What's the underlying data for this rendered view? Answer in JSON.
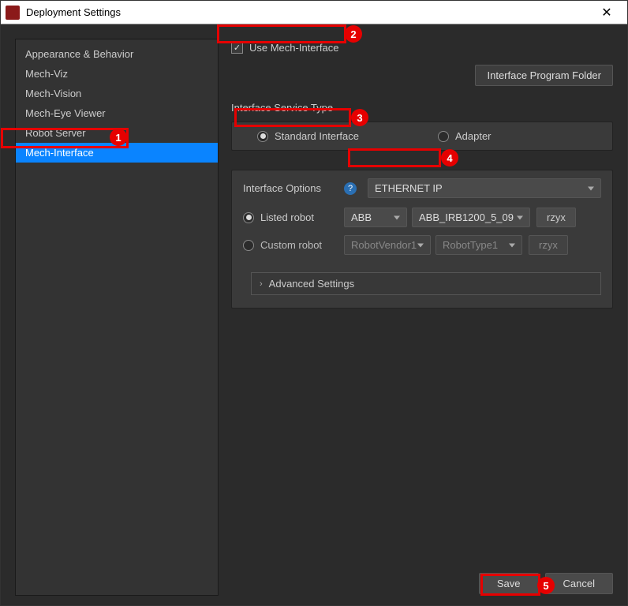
{
  "window": {
    "title": "Deployment Settings",
    "close_glyph": "✕"
  },
  "sidebar": {
    "items": [
      {
        "label": "Appearance & Behavior"
      },
      {
        "label": "Mech-Viz"
      },
      {
        "label": "Mech-Vision"
      },
      {
        "label": "Mech-Eye Viewer"
      },
      {
        "label": "Robot Server"
      },
      {
        "label": "Mech-Interface"
      }
    ],
    "selected_index": 5
  },
  "main": {
    "use_mech_interface_label": "Use Mech-Interface",
    "use_mech_interface_checked": true,
    "interface_program_folder_btn": "Interface Program Folder",
    "service_type_label": "Interface Service Type",
    "service_type_options": {
      "standard": "Standard Interface",
      "adapter": "Adapter"
    },
    "service_type_selected": "standard",
    "interface_options_label": "Interface Options",
    "interface_options_value": "ETHERNET IP",
    "listed_robot_label": "Listed robot",
    "listed_robot_vendor": "ABB",
    "listed_robot_model": "ABB_IRB1200_5_09",
    "listed_robot_euler": "rzyx",
    "custom_robot_label": "Custom robot",
    "custom_robot_vendor": "RobotVendor1",
    "custom_robot_type": "RobotType1",
    "custom_robot_euler": "rzyx",
    "robot_option_selected": "listed",
    "advanced_settings_label": "Advanced Settings"
  },
  "footer": {
    "save": "Save",
    "cancel": "Cancel"
  },
  "callouts": {
    "c1": "1",
    "c2": "2",
    "c3": "3",
    "c4": "4",
    "c5": "5"
  },
  "icons": {
    "check": "✓",
    "help": "?",
    "chev_right": "›"
  }
}
